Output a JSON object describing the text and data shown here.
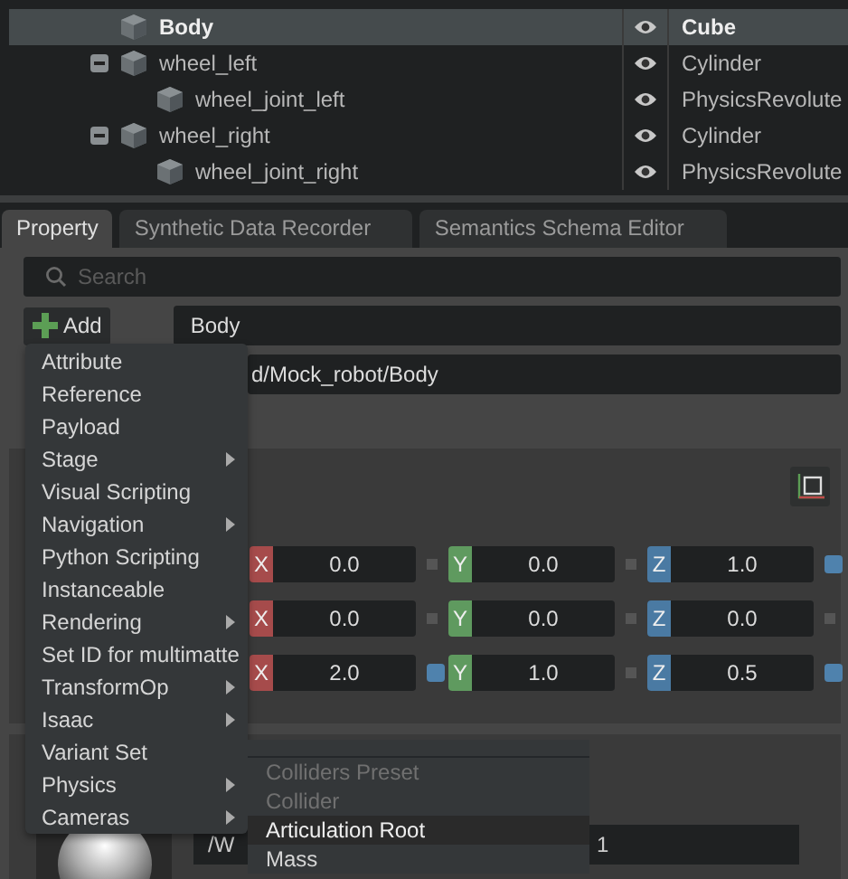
{
  "stage_tree": {
    "rows": [
      {
        "name": "Body",
        "type": "Cube",
        "selected": true
      },
      {
        "name": "wheel_left",
        "type": "Cylinder",
        "selected": false,
        "expanded": true,
        "children": [
          {
            "name": "wheel_joint_left",
            "type": "PhysicsRevolute",
            "selected": false
          }
        ]
      },
      {
        "name": "wheel_right",
        "type": "Cylinder",
        "selected": false,
        "expanded": true,
        "children": [
          {
            "name": "wheel_joint_right",
            "type": "PhysicsRevolute",
            "selected": false
          }
        ]
      }
    ]
  },
  "tabs": [
    {
      "label": "Property",
      "selected": true
    },
    {
      "label": "Synthetic Data Recorder",
      "selected": false
    },
    {
      "label": "Semantics Schema Editor",
      "selected": false
    }
  ],
  "search": {
    "placeholder": "Search"
  },
  "add_button": {
    "label": "Add"
  },
  "name_field": {
    "value": "Body"
  },
  "path_field": {
    "value": "d/Mock_robot/Body"
  },
  "transform_rows": [
    {
      "components": [
        {
          "axis": "X",
          "value": "0.0",
          "changed": false
        },
        {
          "axis": "Y",
          "value": "0.0",
          "changed": false
        },
        {
          "axis": "Z",
          "value": "1.0",
          "changed": true
        }
      ]
    },
    {
      "components": [
        {
          "axis": "X",
          "value": "0.0",
          "changed": false
        },
        {
          "axis": "Y",
          "value": "0.0",
          "changed": false
        },
        {
          "axis": "Z",
          "value": "0.0",
          "changed": false
        }
      ]
    },
    {
      "components": [
        {
          "axis": "X",
          "value": "2.0",
          "changed": true
        },
        {
          "axis": "Y",
          "value": "1.0",
          "changed": false
        },
        {
          "axis": "Z",
          "value": "0.5",
          "changed": true
        }
      ]
    }
  ],
  "material_field": {
    "value": "/W",
    "value_end": "1"
  },
  "add_menu": [
    {
      "label": "Attribute",
      "submenu": false
    },
    {
      "label": "Reference",
      "submenu": false
    },
    {
      "label": "Payload",
      "submenu": false
    },
    {
      "label": "Stage",
      "submenu": true
    },
    {
      "label": "Visual Scripting",
      "submenu": false
    },
    {
      "label": "Navigation",
      "submenu": true
    },
    {
      "label": "Python Scripting",
      "submenu": false
    },
    {
      "label": "Instanceable",
      "submenu": false
    },
    {
      "label": "Rendering",
      "submenu": true
    },
    {
      "label": "Set ID for multimatte",
      "submenu": false
    },
    {
      "label": "TransformOp",
      "submenu": true
    },
    {
      "label": "Isaac",
      "submenu": true
    },
    {
      "label": "Variant Set",
      "submenu": false
    },
    {
      "label": "Physics",
      "submenu": true
    },
    {
      "label": "Cameras",
      "submenu": true
    }
  ],
  "physics_submenu": [
    {
      "label": "Colliders Preset",
      "disabled": true,
      "selected": false
    },
    {
      "label": "Collider",
      "disabled": true,
      "selected": false
    },
    {
      "label": "Articulation Root",
      "disabled": false,
      "selected": true
    },
    {
      "label": "Mass",
      "disabled": false,
      "selected": false
    }
  ]
}
